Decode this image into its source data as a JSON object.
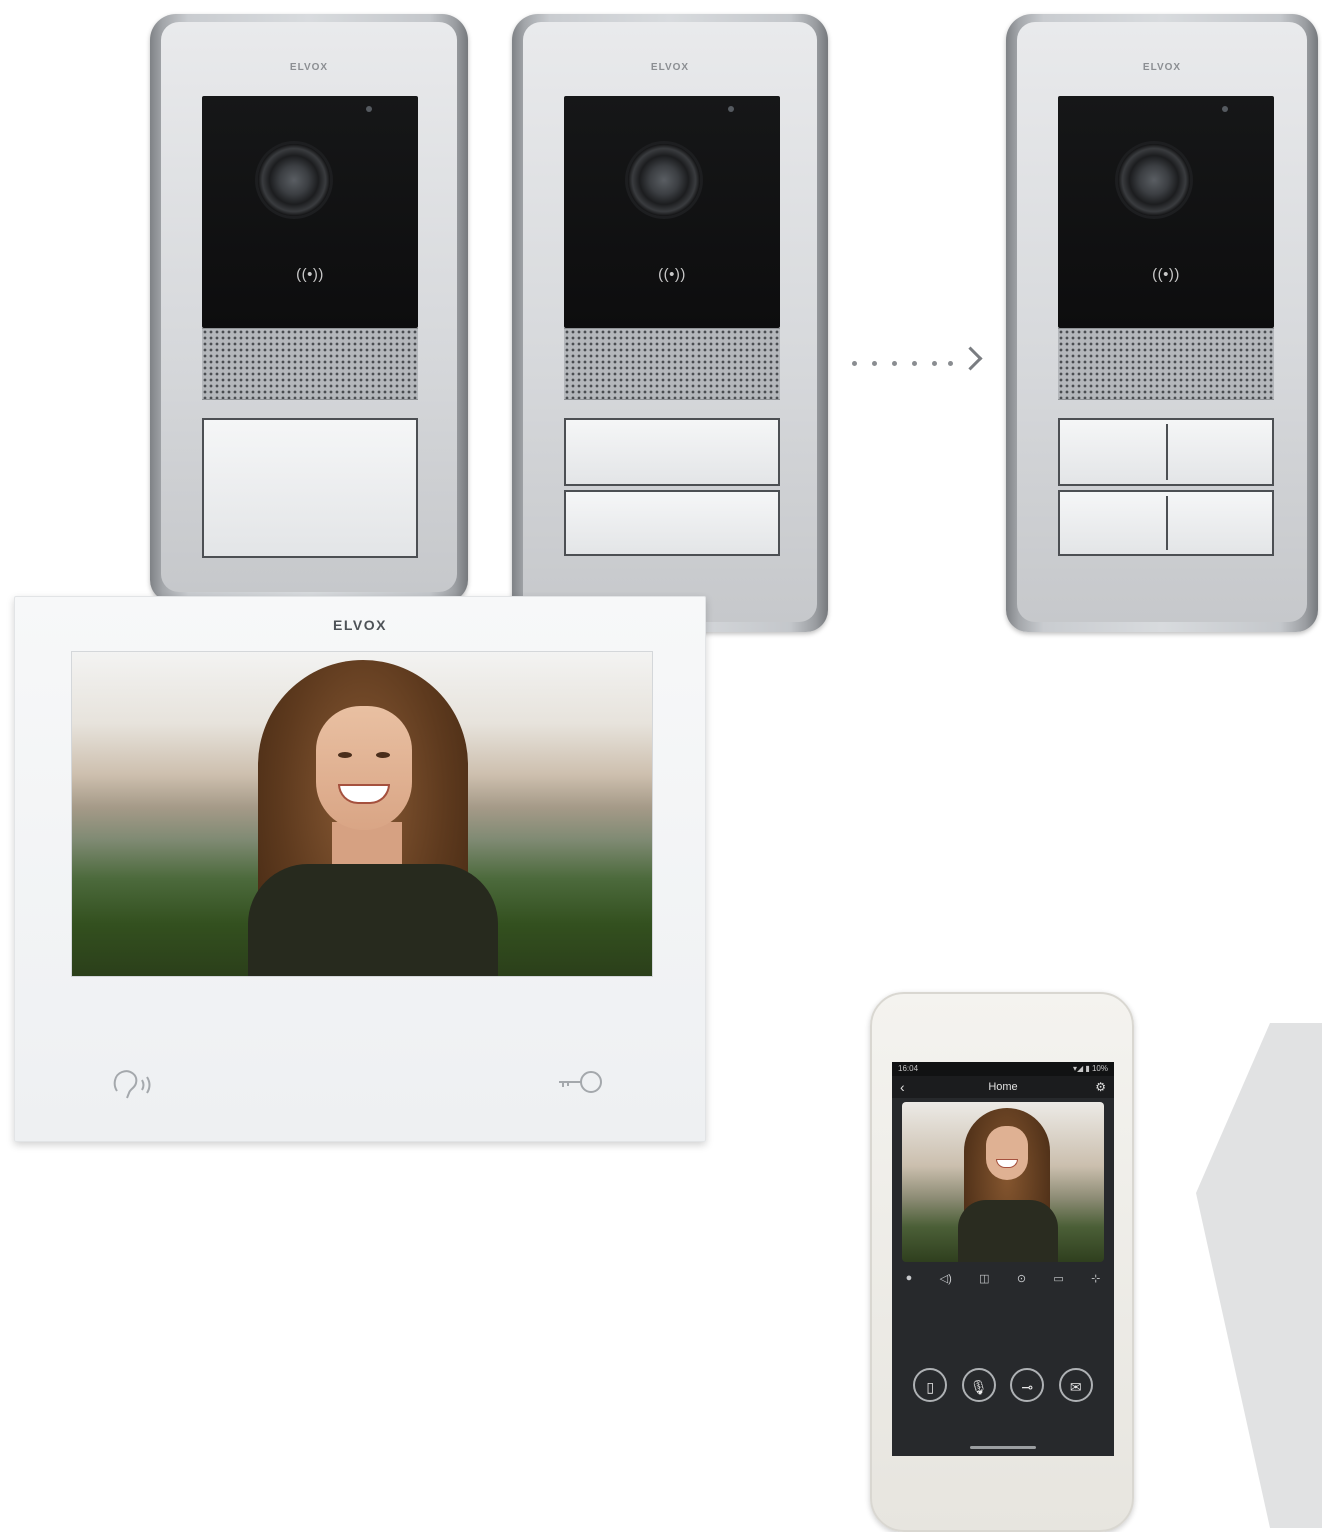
{
  "entry_panels": [
    {
      "brand": "ELVOX",
      "nfc_symbol": "((•))",
      "button_rows": 1,
      "buttons_per_row": 1
    },
    {
      "brand": "ELVOX",
      "nfc_symbol": "((•))",
      "button_rows": 2,
      "buttons_per_row": 1
    },
    {
      "brand": "ELVOX",
      "nfc_symbol": "((•))",
      "button_rows": 2,
      "buttons_per_row": 2
    }
  ],
  "arrow": {
    "symbol": "›"
  },
  "monitor": {
    "brand": "ELVOX",
    "talk_icon": "speaker-call-icon",
    "talk_glyph": "🗨︎",
    "key_icon": "key-icon",
    "key_glyph": "⚿"
  },
  "phone": {
    "status_time": "16:04",
    "status_right": "▾◢ ▮ 10%",
    "nav_title": "Home",
    "back_glyph": "‹",
    "gear_glyph": "⚙",
    "toolbar": [
      "●",
      "◁)",
      "◫",
      "⊙",
      "▭",
      "⊹"
    ],
    "actions": [
      "▯",
      "🎙︎",
      "⊸",
      "✉"
    ]
  },
  "colors": {
    "panel_metal": "#d8dbde",
    "panel_glass": "#111213",
    "monitor_body": "#f2f4f6",
    "phone_screen": "#27292c",
    "grey_shape": "#e1e2e3"
  }
}
